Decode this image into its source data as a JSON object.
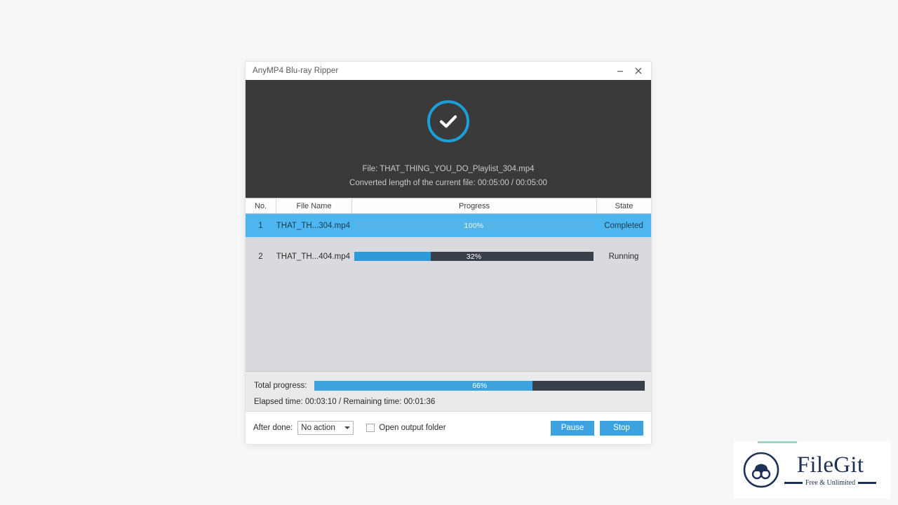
{
  "window": {
    "title": "AnyMP4 Blu-ray Ripper",
    "minimize_icon": "minimize-icon",
    "close_icon": "close-icon"
  },
  "hero": {
    "status_icon": "checkmark-icon",
    "accent_color": "#1a9fd9",
    "background_color": "#3a3a3a",
    "file_line": "File: THAT_THING_YOU_DO_Playlist_304.mp4",
    "length_line": "Converted length of the current file: 00:05:00 / 00:05:00"
  },
  "table": {
    "columns": [
      "No.",
      "File Name",
      "Progress",
      "State"
    ],
    "rows": [
      {
        "no": "1",
        "file_name": "THAT_TH...304.mp4",
        "progress_text": "100%",
        "progress_value": 100,
        "state": "Completed",
        "selected": true
      },
      {
        "no": "2",
        "file_name": "THAT_TH...404.mp4",
        "progress_text": "32%",
        "progress_value": 32,
        "state": "Running",
        "selected": false
      }
    ]
  },
  "status": {
    "total_label": "Total progress:",
    "total_progress_text": "66%",
    "total_progress_value": 66,
    "time_line": "Elapsed time: 00:03:10 / Remaining time: 00:01:36"
  },
  "toolbar": {
    "after_done_label": "After done:",
    "after_done_value": "No action",
    "after_done_options": [
      "No action"
    ],
    "open_folder_label": "Open output folder",
    "open_folder_checked": false,
    "pause_label": "Pause",
    "stop_label": "Stop",
    "button_color": "#3da3e0"
  },
  "watermark": {
    "name": "FileGit",
    "tagline": "Free & Unlimited",
    "logo_icon": "binoculars-circle-icon",
    "color": "#1d3055"
  }
}
